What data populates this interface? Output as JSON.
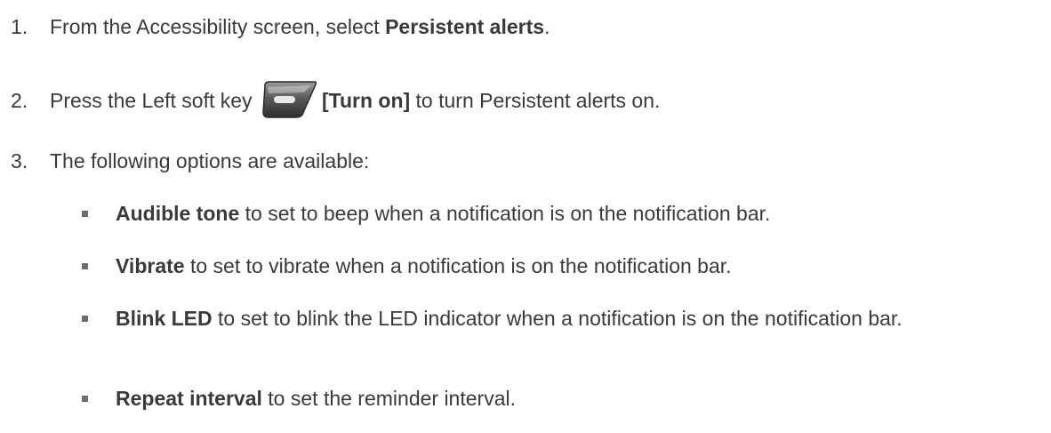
{
  "steps": [
    {
      "number": "1.",
      "text_before": "From the Accessibility screen, select ",
      "bold": "Persistent alerts",
      "text_after": "."
    },
    {
      "number": "2.",
      "text_before": "Press the Left soft key ",
      "icon": "left-soft-key-icon",
      "bold": "[Turn on]",
      "text_after": " to turn Persistent alerts on."
    },
    {
      "number": "3.",
      "text_before": "The following options are available:"
    }
  ],
  "options": [
    {
      "bold": "Audible tone",
      "text": " to set to beep when a notification is on the notification bar."
    },
    {
      "bold": "Vibrate",
      "text": " to set to vibrate when a notification is on the notification bar."
    },
    {
      "bold": "Blink LED",
      "text": " to set to blink the LED indicator when a notification is on the notification bar."
    },
    {
      "bold": "Repeat interval",
      "text": " to set the reminder interval."
    }
  ],
  "colors": {
    "text": "#3a3a3a",
    "bullet": "#6d6d6d",
    "softkey_body": "#5b5b5b",
    "softkey_highlight": "#d8d8d8"
  }
}
